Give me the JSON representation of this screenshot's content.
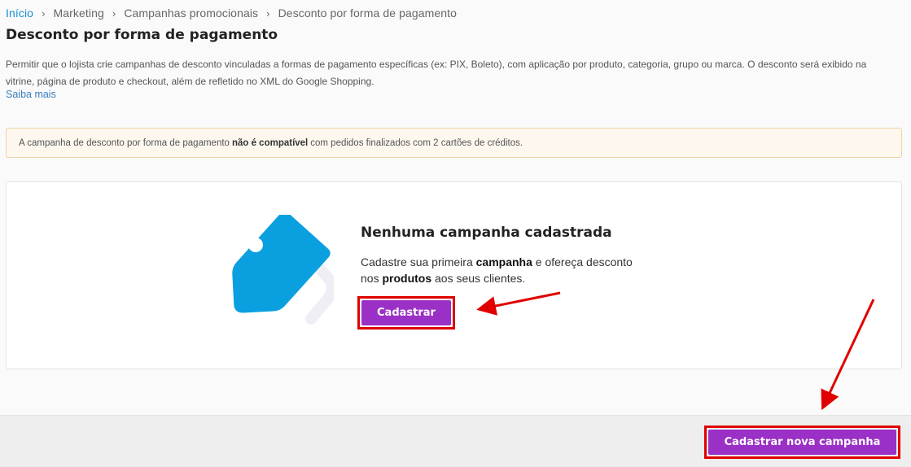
{
  "breadcrumb": {
    "items": [
      "Início",
      "Marketing",
      "Campanhas promocionais",
      "Desconto por forma de pagamento"
    ],
    "separator": "›"
  },
  "page": {
    "title": "Desconto por forma de pagamento",
    "description": "Permitir que o lojista crie campanhas de desconto vinculadas a formas de pagamento específicas (ex: PIX, Boleto), com aplicação por produto, categoria, grupo ou marca. O desconto será exibido na vitrine, página de produto e checkout, além de refletido no XML do Google Shopping.",
    "learn_more": "Saiba mais"
  },
  "alert": {
    "text_before": "A campanha de desconto por forma de pagamento",
    "text_bold": "não é compatível",
    "text_after": "com pedidos finalizados com 2 cartões de créditos."
  },
  "empty_state": {
    "title": "Nenhuma campanha cadastrada",
    "line_part1": "Cadastre sua primeira",
    "line_bold1": "campanha",
    "line_part2": "e ofereça desconto nos",
    "line_bold2": "produtos",
    "line_part3": "aos seus clientes.",
    "button_label": "Cadastrar",
    "icon": "price-tag-icon"
  },
  "footer": {
    "button_label": "Cadastrar nova campanha"
  },
  "colors": {
    "primary_button": "#9b30c6",
    "highlight_outline": "#e00000",
    "tag_blue": "#0aa0e0",
    "link": "#1a8fd6"
  }
}
